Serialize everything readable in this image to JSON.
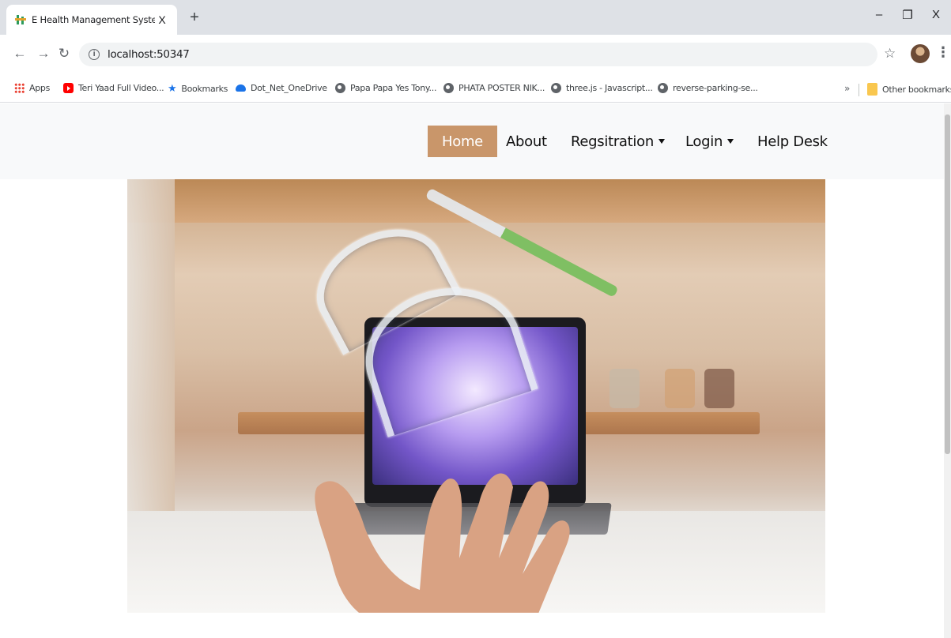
{
  "browser": {
    "tab": {
      "title": "E Health Management System",
      "close_glyph": "X"
    },
    "new_tab_glyph": "+",
    "window_controls": {
      "minimize": "–",
      "restore": "❐",
      "close": "X"
    },
    "address": "localhost:50347",
    "bookmarks": [
      {
        "label": "Apps",
        "icon": "apps-grid-icon"
      },
      {
        "label": "Teri Yaad Full Video...",
        "icon": "youtube-icon"
      },
      {
        "label": "Bookmarks",
        "icon": "star-icon"
      },
      {
        "label": "Dot_Net_OneDrive",
        "icon": "onedrive-icon"
      },
      {
        "label": "Papa Papa Yes Tony...",
        "icon": "globe-icon"
      },
      {
        "label": "PHATA POSTER NIK...",
        "icon": "globe-icon"
      },
      {
        "label": "three.js - Javascript...",
        "icon": "globe-icon"
      },
      {
        "label": "reverse-parking-se...",
        "icon": "globe-icon"
      }
    ],
    "more_bookmarks": "»",
    "other_bookmarks": "Other bookmarks"
  },
  "site": {
    "nav": {
      "home": "Home",
      "about": "About",
      "registration": "Regsitration",
      "login": "Login",
      "help_desk": "Help Desk"
    },
    "active_nav": "Home",
    "accent_color": "#c9966a",
    "hero": {
      "image": "hand-with-floating-dental-aligners-and-syringe"
    }
  }
}
